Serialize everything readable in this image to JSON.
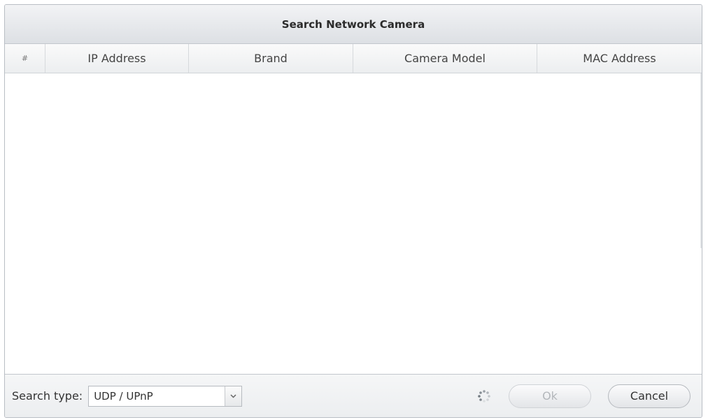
{
  "dialog": {
    "title": "Search Network Camera"
  },
  "table": {
    "columns": [
      "#",
      "IP Address",
      "Brand",
      "Camera Model",
      "MAC Address"
    ],
    "rows": []
  },
  "footer": {
    "search_type_label": "Search type:",
    "search_type_value": "UDP / UPnP",
    "ok_label": "Ok",
    "cancel_label": "Cancel"
  },
  "icons": {
    "dropdown": "chevron-down-icon",
    "loading": "spinner-icon"
  }
}
